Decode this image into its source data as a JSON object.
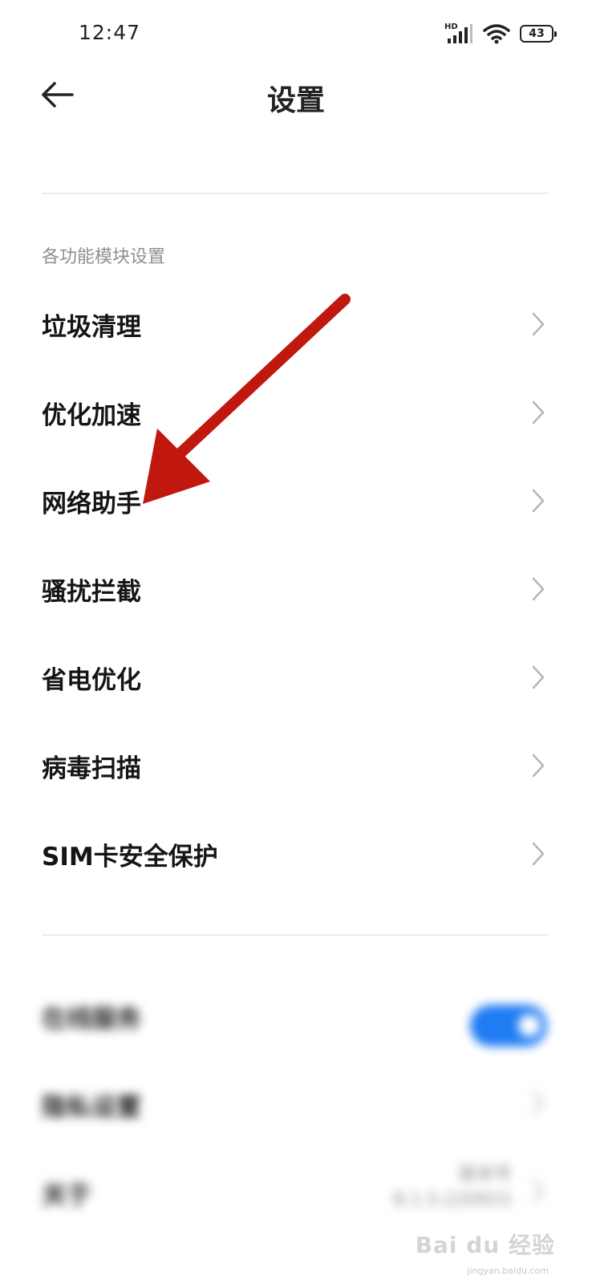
{
  "status": {
    "time": "12:47",
    "hd_label": "HD",
    "battery": "43"
  },
  "header": {
    "title": "设置"
  },
  "section": {
    "label": "各功能模块设置"
  },
  "menu": {
    "items": [
      {
        "label": "垃圾清理"
      },
      {
        "label": "优化加速"
      },
      {
        "label": "网络助手"
      },
      {
        "label": "骚扰拦截"
      },
      {
        "label": "省电优化"
      },
      {
        "label": "病毒扫描"
      },
      {
        "label": "SIM卡安全保护"
      }
    ]
  },
  "blurred": {
    "online_service": {
      "label": "在线服务",
      "enabled": true
    },
    "privacy": {
      "label": "隐私设置"
    },
    "about": {
      "label": "关于",
      "version_label": "版本号",
      "version_value": "8.1.5-220915"
    }
  },
  "watermark": {
    "text": "Bai du 经验",
    "sub": "jingyan.baidu.com"
  },
  "colors": {
    "accent": "#1f7cf3",
    "arrow": "#c0170f",
    "section_label": "#8c8f96"
  }
}
